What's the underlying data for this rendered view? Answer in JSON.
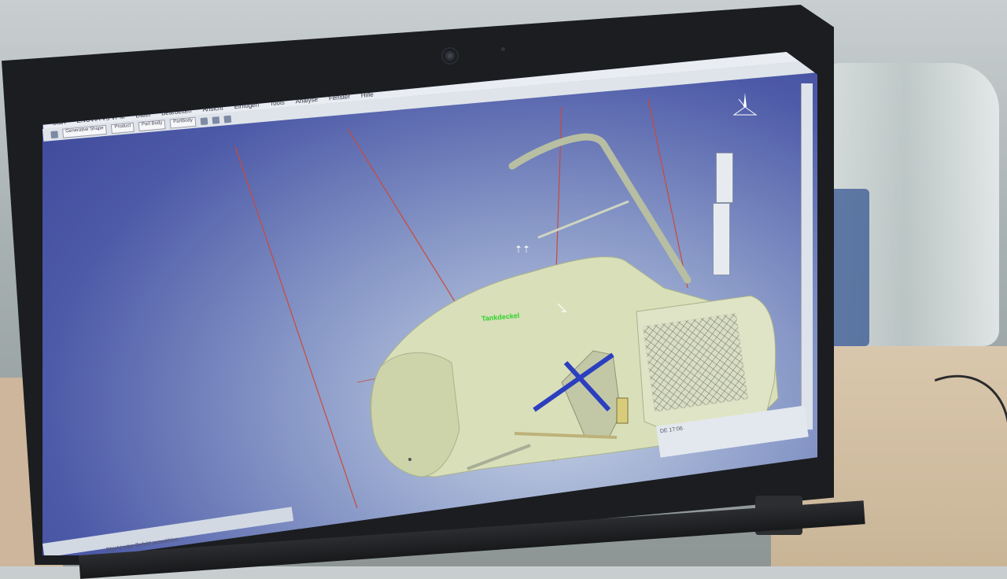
{
  "app": {
    "menu": [
      "Start",
      "ENOVIA V5 VPM",
      "Datei",
      "Bearbeiten",
      "Ansicht",
      "Einfügen",
      "Tools",
      "Analyse",
      "Fenster",
      "Hilfe"
    ],
    "toolbar_selects": [
      "Generative Shape",
      "Product",
      "Part Body",
      "PartBody"
    ],
    "model_label": "Tankdeckel",
    "status_text": "Objekt oder Befehl auswählen",
    "tray_text": "DE  17:06"
  },
  "icons": {
    "compass": "compass-icon",
    "cursor": "move-cursor-icon",
    "webcam": "webcam-icon"
  },
  "colors": {
    "viewport_top": "#3a4595",
    "viewport_bottom": "#c8d4e6",
    "model": "#d9dfb9",
    "axis": "#c94a3a",
    "accent": "#2b3fbf"
  }
}
